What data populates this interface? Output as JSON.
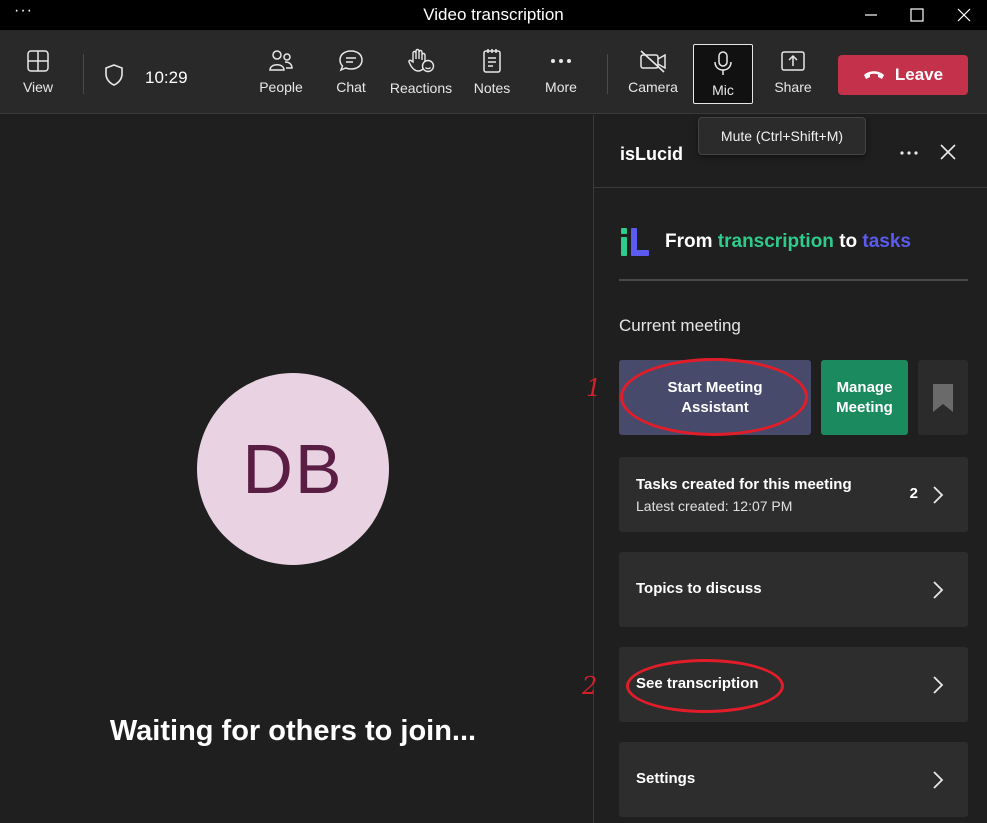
{
  "window": {
    "title": "Video transcription",
    "menu_glyph": "···"
  },
  "toolbar": {
    "view": "View",
    "time": "10:29",
    "people": "People",
    "chat": "Chat",
    "reactions": "Reactions",
    "notes": "Notes",
    "more": "More",
    "camera": "Camera",
    "mic": "Mic",
    "share": "Share",
    "leave": "Leave"
  },
  "tooltip": "Mute (Ctrl+Shift+M)",
  "stage": {
    "avatar_initials": "DB",
    "waiting_text": "Waiting for others to join..."
  },
  "panel": {
    "name": "isLucid",
    "brand": {
      "from": "From",
      "transcription": "transcription",
      "to": "to",
      "tasks": "tasks"
    },
    "section_label": "Current meeting",
    "start_line1": "Start Meeting",
    "start_line2": "Assistant",
    "manage_line1": "Manage",
    "manage_line2": "Meeting",
    "cards": [
      {
        "title": "Tasks created for this meeting",
        "subtitle": "Latest created: 12:07 PM",
        "count": "2"
      },
      {
        "title": "Topics to discuss"
      },
      {
        "title": "See transcription"
      },
      {
        "title": "Settings"
      }
    ]
  },
  "annotations": {
    "one": "1",
    "two": "2"
  },
  "colors": {
    "leave": "#c4314b",
    "start_button": "#474a6b",
    "manage_button": "#1b8a5e",
    "brand_green": "#2ecc8a",
    "brand_purple": "#5b5bf0",
    "annotation_red": "#e11d2a"
  }
}
